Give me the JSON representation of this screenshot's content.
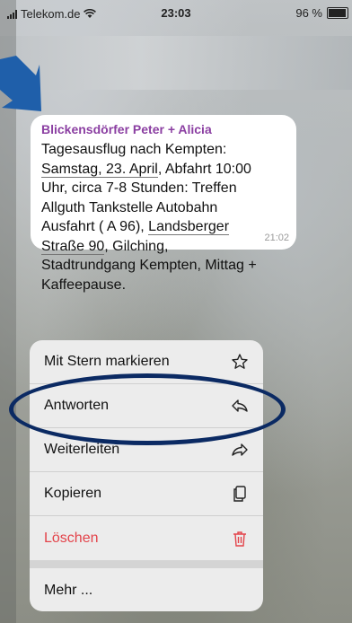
{
  "status_bar": {
    "carrier": "Telekom.de",
    "time": "23:03",
    "battery": "96 %"
  },
  "message": {
    "sender": "Blickensdörfer Peter + Alicia",
    "line1": "Tagesausflug nach Kempten:",
    "date_link": "Samstag, 23. April",
    "after_date": ", Abfahrt 10:00",
    "line3": "Uhr, circa 7-8 Stunden: Treffen",
    "line4": "Allguth Tankstelle Autobahn",
    "line5_pre": "Ausfahrt ( A 96), ",
    "address_part1": "Landsberger",
    "address_part2": "Straße 90",
    "line6_post": ", Gilching,",
    "line7": "Stadtrundgang Kempten, Mittag +",
    "line8": "Kaffeepause.",
    "time": "21:02"
  },
  "menu": {
    "items": [
      {
        "label": "Mit Stern markieren",
        "icon": "star-icon"
      },
      {
        "label": "Antworten",
        "icon": "reply-icon"
      },
      {
        "label": "Weiterleiten",
        "icon": "forward-icon"
      },
      {
        "label": "Kopieren",
        "icon": "copy-icon"
      },
      {
        "label": "Löschen",
        "icon": "trash-icon"
      },
      {
        "label": "Mehr ...",
        "icon": ""
      }
    ]
  },
  "colors": {
    "sender": "#8b3fa2",
    "delete": "#e3434a",
    "annotation": "#0b2a63",
    "arrow": "#1f5faa"
  }
}
